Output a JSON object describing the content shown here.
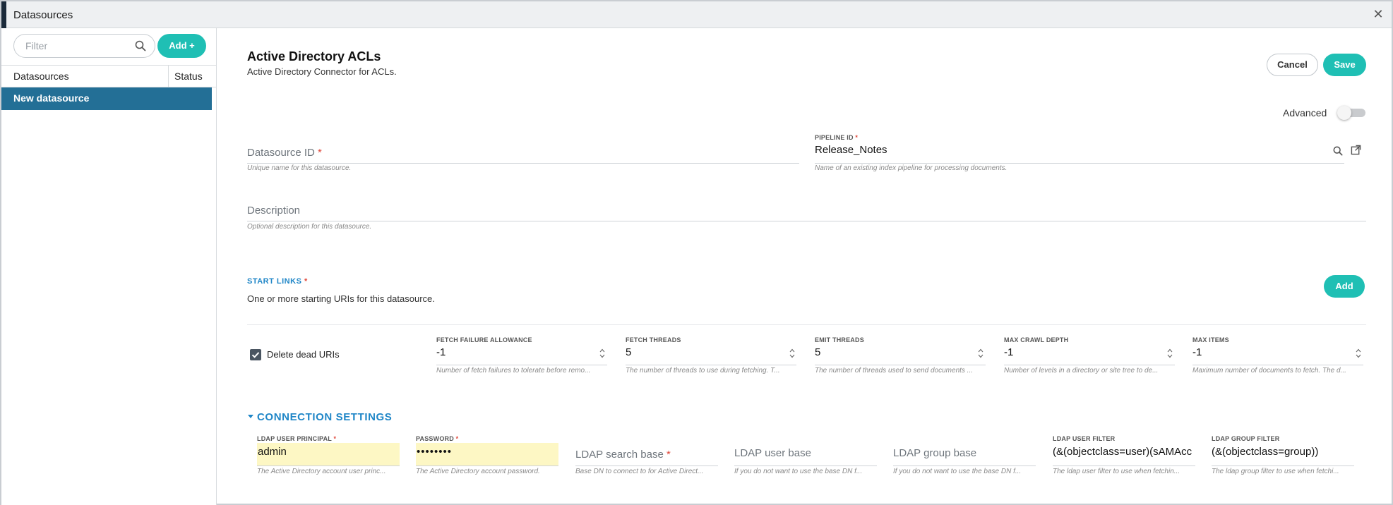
{
  "window": {
    "title": "Datasources"
  },
  "sidebar": {
    "filter_placeholder": "Filter",
    "add_label": "Add +",
    "columns": {
      "name": "Datasources",
      "status": "Status"
    },
    "items": [
      {
        "label": "New datasource",
        "selected": true
      }
    ]
  },
  "header": {
    "title": "Active Directory ACLs",
    "subtitle": "Active Directory Connector for ACLs.",
    "cancel_label": "Cancel",
    "save_label": "Save",
    "advanced_label": "Advanced",
    "advanced_on": false
  },
  "fields": {
    "datasource_id": {
      "label": "Datasource ID",
      "required": "*",
      "value": "",
      "help": "Unique name for this datasource."
    },
    "pipeline_id": {
      "label": "PIPELINE ID",
      "required": "*",
      "value": "Release_Notes",
      "help": "Name of an existing index pipeline for processing documents."
    },
    "description": {
      "label": "Description",
      "value": "",
      "help": "Optional description for this datasource."
    }
  },
  "start_links": {
    "title": "START LINKS",
    "required": "*",
    "description": "One or more starting URIs for this datasource.",
    "add_label": "Add"
  },
  "crawl": {
    "delete_dead_label": "Delete dead URIs",
    "delete_dead_checked": true,
    "fetch_failure": {
      "label": "FETCH FAILURE ALLOWANCE",
      "value": "-1",
      "help": "Number of fetch failures to tolerate before remo..."
    },
    "fetch_threads": {
      "label": "FETCH THREADS",
      "value": "5",
      "help": "The number of threads to use during fetching. T..."
    },
    "emit_threads": {
      "label": "EMIT THREADS",
      "value": "5",
      "help": "The number of threads used to send documents ..."
    },
    "max_depth": {
      "label": "MAX CRAWL DEPTH",
      "value": "-1",
      "help": "Number of levels in a directory or site tree to de..."
    },
    "max_items": {
      "label": "MAX ITEMS",
      "value": "-1",
      "help": "Maximum number of documents to fetch. The d..."
    }
  },
  "connection": {
    "title": "CONNECTION SETTINGS",
    "user_principal": {
      "label": "LDAP USER PRINCIPAL",
      "required": "*",
      "value": "admin",
      "help": "The Active Directory account user princ..."
    },
    "password": {
      "label": "PASSWORD",
      "required": "*",
      "value": "••••••••",
      "help": "The Active Directory account password."
    },
    "search_base": {
      "label": "LDAP search base",
      "required": "*",
      "value": "",
      "help": "Base DN to connect to for Active Direct..."
    },
    "user_base": {
      "label": "LDAP user base",
      "value": "",
      "help": "If you do not want to use the base DN f..."
    },
    "group_base": {
      "label": "LDAP group base",
      "value": "",
      "help": "If you do not want to use the base DN f..."
    },
    "user_filter": {
      "label": "LDAP USER FILTER",
      "value": "(&(objectclass=user)(sAMAcc",
      "help": "The ldap user filter to use when fetchin..."
    },
    "group_filter": {
      "label": "LDAP GROUP FILTER",
      "value": "(&(objectclass=group))",
      "help": "The ldap group filter to use when fetchi..."
    }
  },
  "colors": {
    "accent": "#1fbfb4",
    "link": "#1f86c7",
    "selected_row": "#236f96",
    "required": "#e0483b"
  }
}
